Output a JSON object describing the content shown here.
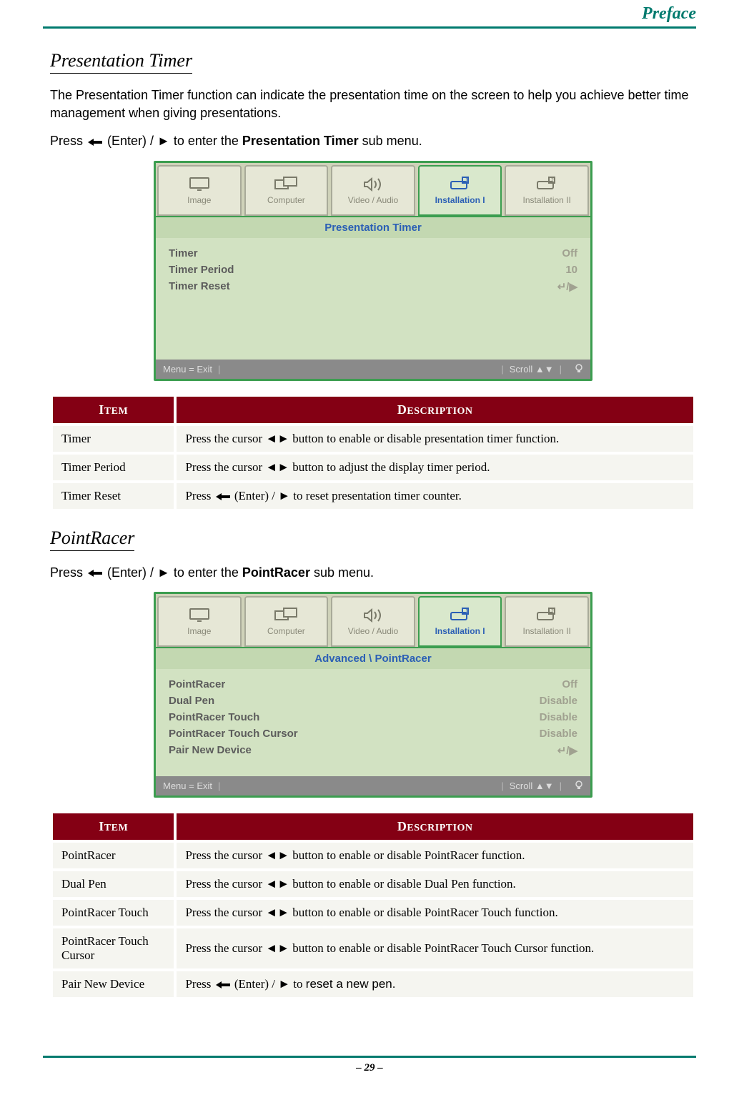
{
  "header": {
    "preface": "Preface"
  },
  "section1": {
    "heading": "Presentation Timer",
    "para1": "The Presentation Timer function can indicate the presentation time on the screen to help you achieve better time management when giving presentations.",
    "para2_pre": "Press ",
    "para2_mid": " (Enter) / ► to enter the ",
    "para2_strong": "Presentation Timer",
    "para2_post": " sub menu."
  },
  "menu1": {
    "tabs": [
      {
        "label": "Image"
      },
      {
        "label": "Computer"
      },
      {
        "label": "Video / Audio"
      },
      {
        "label": "Installation I"
      },
      {
        "label": "Installation II"
      }
    ],
    "title": "Presentation Timer",
    "rows": [
      {
        "label": "Timer",
        "value": "Off"
      },
      {
        "label": "Timer Period",
        "value": "10"
      },
      {
        "label": "Timer Reset",
        "value": "↵/▶"
      }
    ],
    "statusbar": {
      "left": "Menu = Exit",
      "scroll": "Scroll ▲▼"
    }
  },
  "table_headers": {
    "item_i": "I",
    "item_rest": "TEM",
    "desc_d": "D",
    "desc_rest": "ESCRIPTION"
  },
  "table1": {
    "rows": [
      {
        "item": "Timer",
        "desc_pre": "Press the cursor ◄► button to enable or disable presentation timer function.",
        "has_enter": false
      },
      {
        "item": "Timer Period",
        "desc_pre": "Press the cursor ◄► button to adjust the display timer period.",
        "has_enter": false
      },
      {
        "item": "Timer Reset",
        "desc_pre": "Press ",
        "desc_post": " (Enter) / ► to reset presentation timer counter.",
        "has_enter": true
      }
    ]
  },
  "section2": {
    "heading": "PointRacer",
    "para_pre": "Press ",
    "para_mid": " (Enter) / ► to enter the ",
    "para_strong": "PointRacer",
    "para_post": " sub menu."
  },
  "menu2": {
    "tabs": [
      {
        "label": "Image"
      },
      {
        "label": "Computer"
      },
      {
        "label": "Video / Audio"
      },
      {
        "label": "Installation I"
      },
      {
        "label": "Installation II"
      }
    ],
    "title": "Advanced \\ PointRacer",
    "rows": [
      {
        "label": "PointRacer",
        "value": "Off"
      },
      {
        "label": "Dual Pen",
        "value": "Disable"
      },
      {
        "label": "PointRacer Touch",
        "value": "Disable"
      },
      {
        "label": "PointRacer Touch Cursor",
        "value": "Disable"
      },
      {
        "label": "Pair New Device",
        "value": "↵/▶"
      }
    ],
    "statusbar": {
      "left": "Menu = Exit",
      "scroll": "Scroll ▲▼"
    }
  },
  "table2": {
    "rows": [
      {
        "item": "PointRacer",
        "desc_pre": "Press the cursor ◄► button to enable or disable PointRacer function.",
        "has_enter": false
      },
      {
        "item": "Dual Pen",
        "desc_pre": "Press the cursor ◄► button to enable or disable Dual Pen function.",
        "has_enter": false
      },
      {
        "item": "PointRacer Touch",
        "desc_pre": "Press the cursor ◄► button to enable or disable PointRacer Touch function.",
        "has_enter": false
      },
      {
        "item": "PointRacer Touch Cursor",
        "desc_pre": "Press the cursor ◄► button to enable or disable PointRacer Touch Cursor function.",
        "has_enter": false
      },
      {
        "item": "Pair New Device",
        "desc_pre": "Press ",
        "desc_post": " (Enter) / ► to ",
        "desc_tail": "reset a new pen.",
        "has_enter": true
      }
    ]
  },
  "footer": {
    "page": "– 29 –"
  }
}
